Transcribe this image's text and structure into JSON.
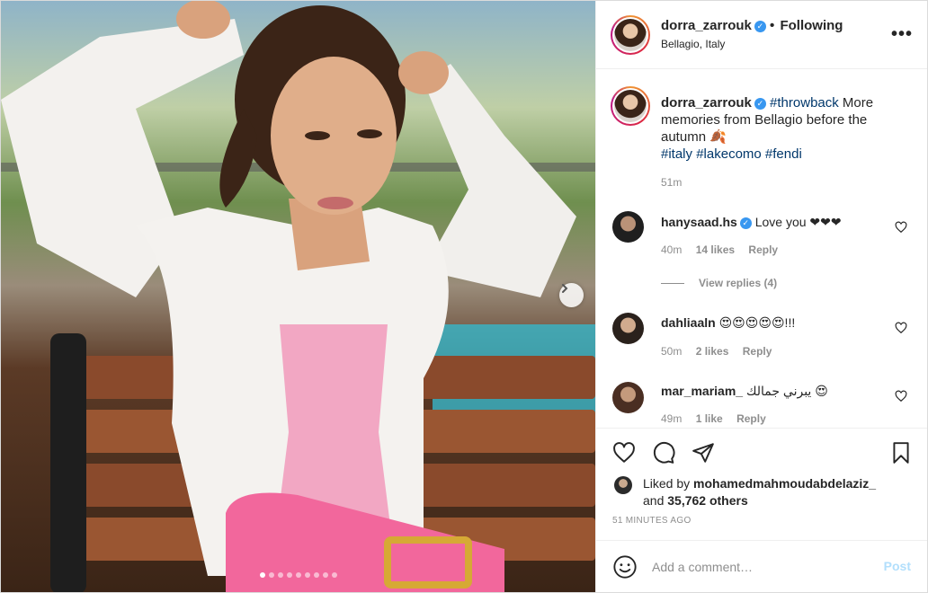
{
  "header": {
    "username": "dorra_zarrouk",
    "separator": "•",
    "follow_status": "Following",
    "location": "Bellagio, Italy",
    "more_icon": "more-options-icon"
  },
  "caption": {
    "username": "dorra_zarrouk",
    "hashtag_1": "#throwback",
    "text": " More memories from Bellagio before the autumn 🍂",
    "hashtag_2": "#italy",
    "hashtag_3": "#lakecomo",
    "hashtag_4": "#fendi",
    "time": "51m"
  },
  "comments": [
    {
      "username": "hanysaad.hs",
      "verified": true,
      "text": "Love you ❤❤❤",
      "time": "40m",
      "likes": "14 likes",
      "reply": "Reply"
    },
    {
      "username": "dahliaaln",
      "verified": false,
      "text": "😍😍😍😍😍!!!",
      "time": "50m",
      "likes": "2 likes",
      "reply": "Reply"
    },
    {
      "username": "mar_mariam_",
      "verified": false,
      "text": "يبرني جمالك 😍",
      "time": "49m",
      "likes": "1 like",
      "reply": "Reply"
    }
  ],
  "view_replies": "View replies (4)",
  "liked": {
    "prefix": "Liked by ",
    "user": "mohamedmahmoudabdelaziz_",
    "and": " and ",
    "others": "35,762 others"
  },
  "timestamp": "51 MINUTES AGO",
  "add_comment": {
    "placeholder": "Add a comment…",
    "post_label": "Post"
  },
  "carousel": {
    "slides": 9,
    "active_index": 0
  },
  "colors": {
    "link": "#00376b",
    "verified": "#3897f0",
    "post_disabled": "#b2dffc",
    "muted": "#8e8e8e"
  }
}
